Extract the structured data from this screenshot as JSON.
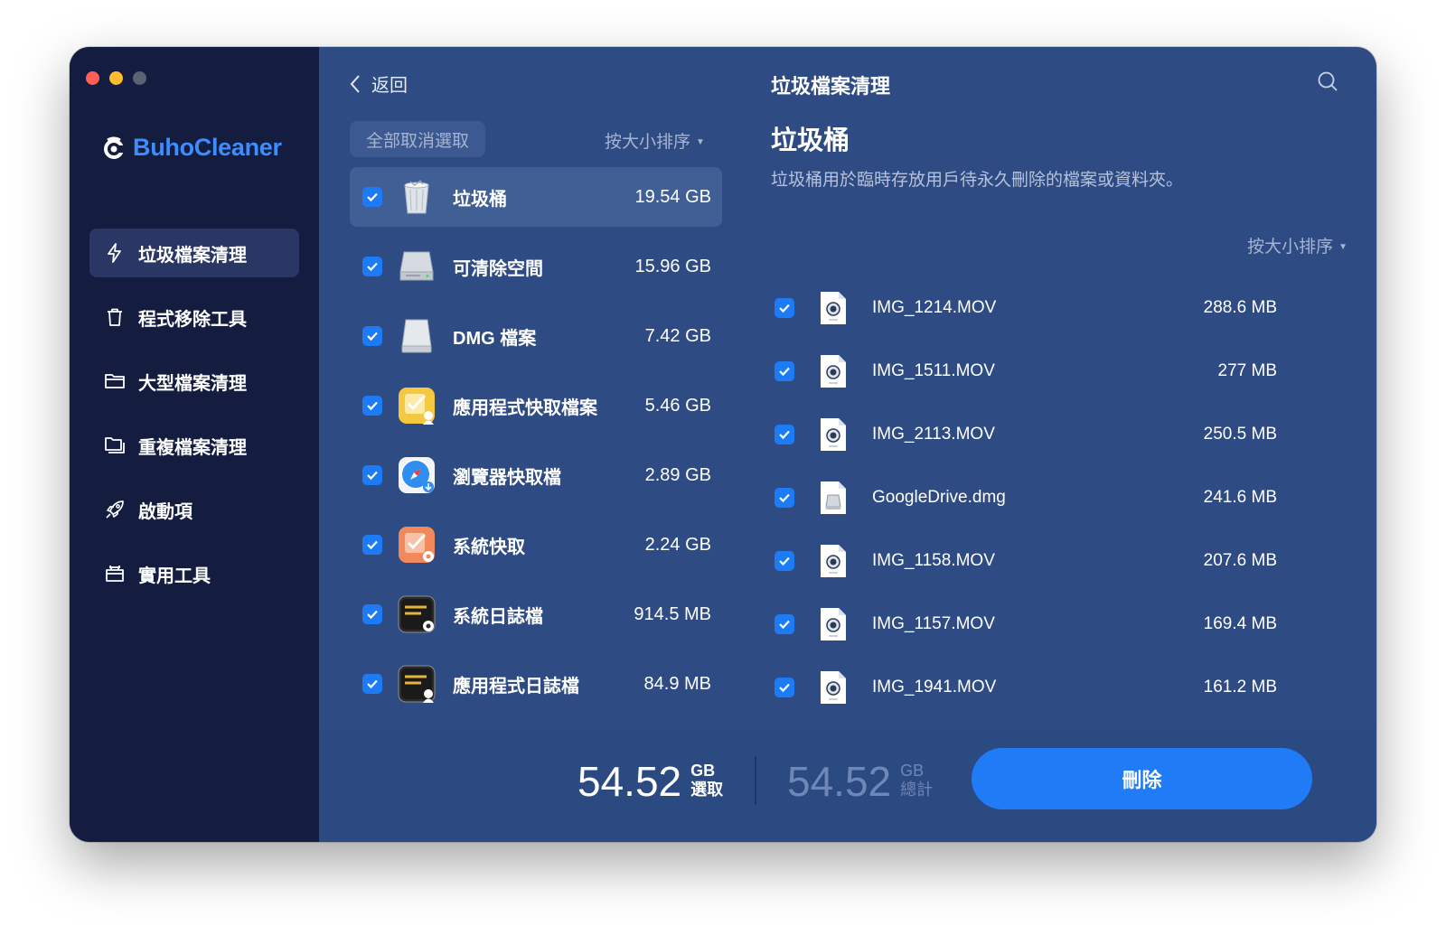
{
  "app": {
    "name": "BuhoCleaner"
  },
  "sidebar": {
    "items": [
      {
        "label": "垃圾檔案清理",
        "icon": "bolt-icon",
        "active": true
      },
      {
        "label": "程式移除工具",
        "icon": "trash-icon",
        "active": false
      },
      {
        "label": "大型檔案清理",
        "icon": "folder-icon",
        "active": false
      },
      {
        "label": "重複檔案清理",
        "icon": "duplicate-folder-icon",
        "active": false
      },
      {
        "label": "啟動項",
        "icon": "rocket-icon",
        "active": false
      },
      {
        "label": "實用工具",
        "icon": "toolbox-icon",
        "active": false
      }
    ]
  },
  "mid": {
    "back_label": "返回",
    "deselect_label": "全部取消選取",
    "sort_label": "按大小排序",
    "categories": [
      {
        "label": "垃圾桶",
        "size": "19.54 GB",
        "checked": true,
        "icon": "trash-bin-icon"
      },
      {
        "label": "可清除空間",
        "size": "15.96 GB",
        "checked": true,
        "icon": "hard-drive-icon"
      },
      {
        "label": "DMG 檔案",
        "size": "7.42 GB",
        "checked": true,
        "icon": "dmg-disk-icon"
      },
      {
        "label": "應用程式快取檔案",
        "size": "5.46 GB",
        "checked": true,
        "icon": "app-cache-icon"
      },
      {
        "label": "瀏覽器快取檔",
        "size": "2.89 GB",
        "checked": true,
        "icon": "safari-icon"
      },
      {
        "label": "系統快取",
        "size": "2.24 GB",
        "checked": true,
        "icon": "system-cache-icon"
      },
      {
        "label": "系統日誌檔",
        "size": "914.5 MB",
        "checked": true,
        "icon": "system-log-icon"
      },
      {
        "label": "應用程式日誌檔",
        "size": "84.9 MB",
        "checked": true,
        "icon": "app-log-icon"
      }
    ]
  },
  "detail": {
    "header_title": "垃圾檔案清理",
    "category_title": "垃圾桶",
    "description": "垃圾桶用於臨時存放用戶待永久刪除的檔案或資料夾。",
    "sort_label": "按大小排序",
    "files": [
      {
        "name": "IMG_1214.MOV",
        "size": "288.6 MB",
        "type": "mov"
      },
      {
        "name": "IMG_1511.MOV",
        "size": "277 MB",
        "type": "mov"
      },
      {
        "name": "IMG_2113.MOV",
        "size": "250.5 MB",
        "type": "mov"
      },
      {
        "name": "GoogleDrive.dmg",
        "size": "241.6 MB",
        "type": "dmg"
      },
      {
        "name": "IMG_1158.MOV",
        "size": "207.6 MB",
        "type": "mov"
      },
      {
        "name": "IMG_1157.MOV",
        "size": "169.4 MB",
        "type": "mov"
      },
      {
        "name": "IMG_1941.MOV",
        "size": "161.2 MB",
        "type": "mov"
      }
    ]
  },
  "footer": {
    "selected_value": "54.52",
    "selected_unit": "GB",
    "selected_label": "選取",
    "total_value": "54.52",
    "total_unit": "GB",
    "total_label": "總計",
    "delete_label": "刪除"
  },
  "colors": {
    "accent": "#1f7cf6",
    "brand": "#3d8dff",
    "sidebar_bg": "#141d3f",
    "main_bg": "#2e4c83"
  }
}
